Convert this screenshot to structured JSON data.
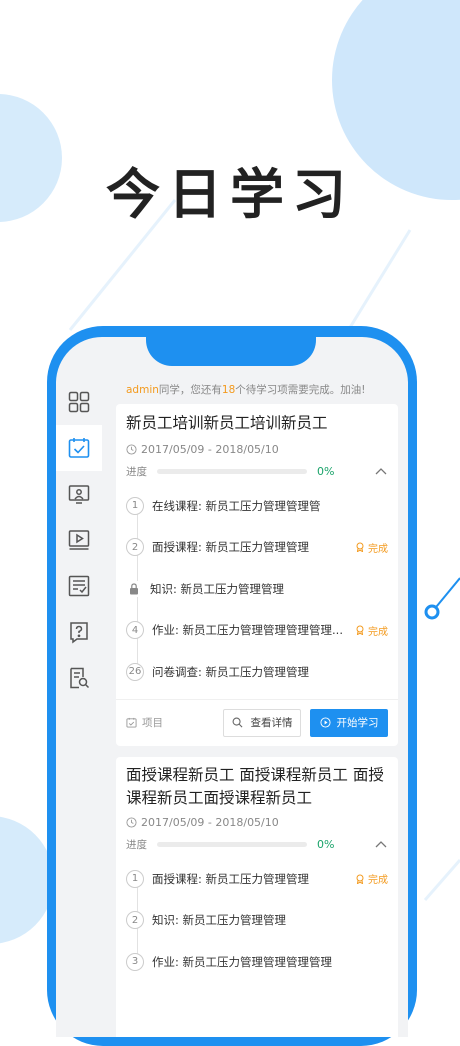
{
  "headline": "今日学习",
  "welcome": {
    "user": "admin",
    "part1": "同学，您还有",
    "count": "18",
    "part2": "个待学习项需要完成。加油!"
  },
  "sidebar": {
    "items": [
      {
        "icon": "grid-icon",
        "active": false
      },
      {
        "icon": "calendar-check-icon",
        "active": true
      },
      {
        "icon": "presentation-icon",
        "active": false
      },
      {
        "icon": "video-icon",
        "active": false
      },
      {
        "icon": "list-check-icon",
        "active": false
      },
      {
        "icon": "question-icon",
        "active": false
      },
      {
        "icon": "doc-search-icon",
        "active": false
      }
    ]
  },
  "cards": [
    {
      "title": "新员工培训新员工培训新员工",
      "date": "2017/05/09 - 2018/05/10",
      "progress_label": "进度",
      "progress": 0,
      "progress_text": "0%",
      "steps": [
        {
          "num": "1",
          "label": "在线课程:  新员工压力管理管理管",
          "done": ""
        },
        {
          "num": "2",
          "label": "面授课程:  新员工压力管理管理",
          "done": "完成"
        },
        {
          "num": "",
          "locked": true,
          "label": "知识:   新员工压力管理管理",
          "done": ""
        },
        {
          "num": "4",
          "label": "作业:  新员工压力管理管理管理管理...",
          "done": "完成"
        },
        {
          "num": "26",
          "label": "问卷调查:  新员工压力管理管理",
          "done": ""
        }
      ],
      "footer": {
        "tag": "项目",
        "detail": "查看详情",
        "start": "开始学习"
      }
    },
    {
      "title": "面授课程新员工 面授课程新员工 面授课程新员工面授课程新员工",
      "date": "2017/05/09 - 2018/05/10",
      "progress_label": "进度",
      "progress": 0,
      "progress_text": "0%",
      "steps": [
        {
          "num": "1",
          "label": "面授课程:  新员工压力管理管理",
          "done": "完成"
        },
        {
          "num": "2",
          "label": "知识:   新员工压力管理管理",
          "done": ""
        },
        {
          "num": "3",
          "label": "作业:  新员工压力管理管理管理管理",
          "done": ""
        }
      ]
    }
  ]
}
